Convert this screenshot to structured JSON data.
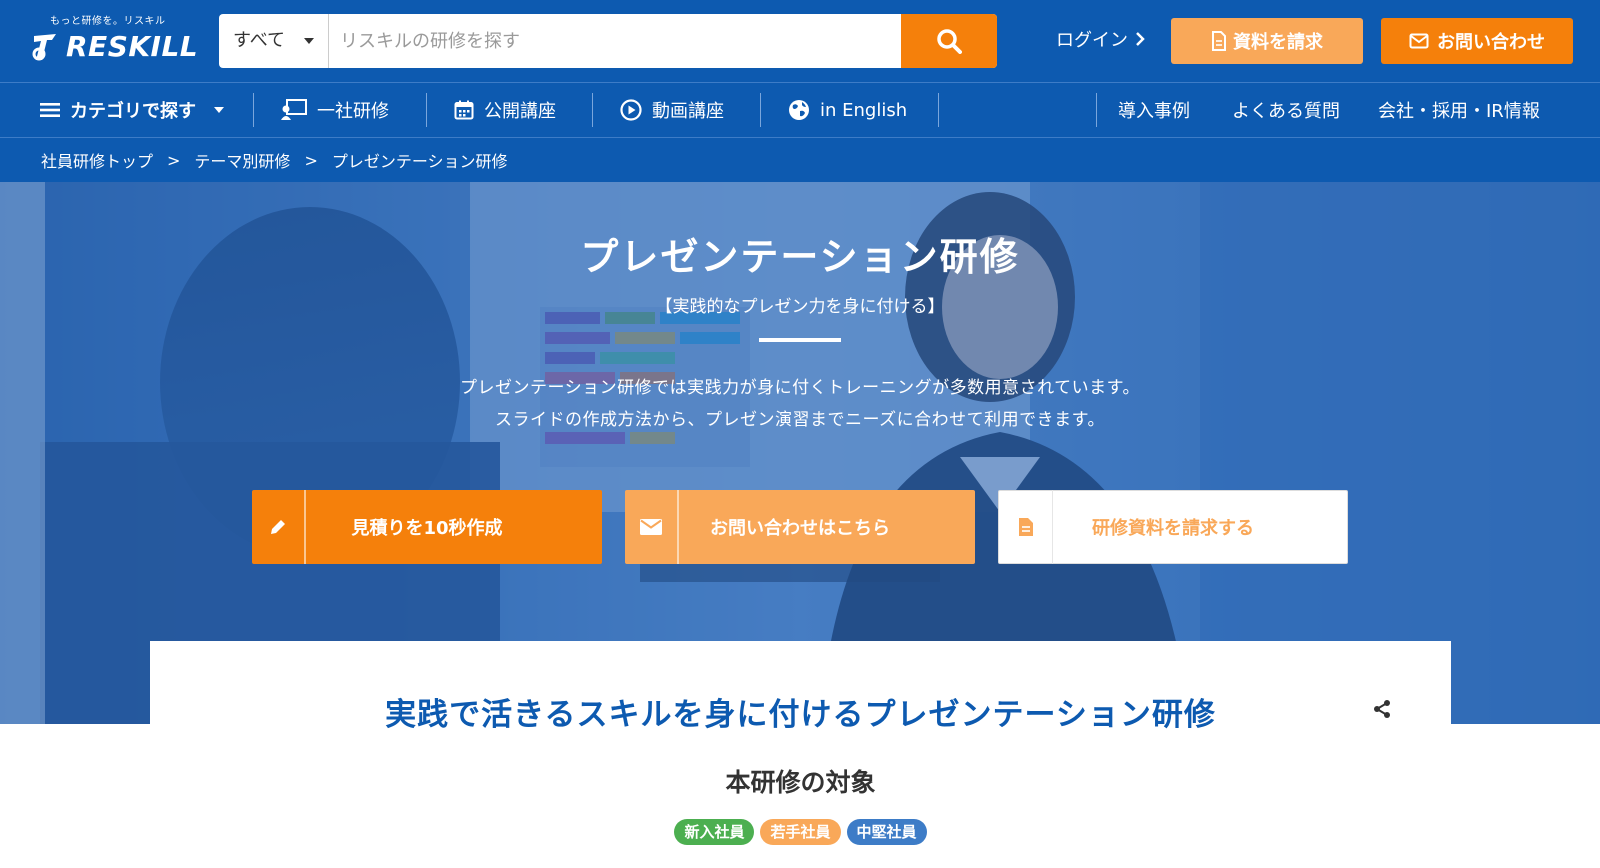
{
  "header": {
    "tagline": "もっと研修を。リスキル",
    "logo_text": "RESKILL",
    "search": {
      "scope": "すべて",
      "placeholder": "リスキルの研修を探す"
    },
    "login": "ログイン",
    "request_docs": "資料を請求",
    "contact": "お問い合わせ"
  },
  "nav": {
    "category": "カテゴリで探す",
    "items": [
      "一社研修",
      "公開講座",
      "動画講座",
      "in English"
    ],
    "right_items": [
      "導入事例",
      "よくある質問",
      "会社・採用・IR情報"
    ]
  },
  "breadcrumb": [
    "社員研修トップ",
    "テーマ別研修",
    "プレゼンテーション研修"
  ],
  "breadcrumb_sep": ">",
  "hero": {
    "title": "プレゼンテーション研修",
    "subtitle": "【実践的なプレゼン力を身に付ける】",
    "desc_line1": "プレゼンテーション研修では実践力が身に付くトレーニングが多数用意されています。",
    "desc_line2": "スライドの作成方法から、プレゼン演習までニーズに合わせて利用できます。",
    "cta_estimate": "見積りを10秒作成",
    "cta_inquiry": "お問い合わせはこちら",
    "cta_material": "研修資料を請求する"
  },
  "content": {
    "title": "実践で活きるスキルを身に付けるプレゼンテーション研修",
    "target_title": "本研修の対象",
    "badges": [
      {
        "label": "新入社員",
        "color": "#4caf50"
      },
      {
        "label": "若手社員",
        "color": "#f9a859"
      },
      {
        "label": "中堅社員",
        "color": "#3d7cc7"
      }
    ]
  },
  "colors": {
    "brand_blue": "#0d5ab0",
    "accent_orange": "#f5800b",
    "light_orange": "#f9a859"
  }
}
